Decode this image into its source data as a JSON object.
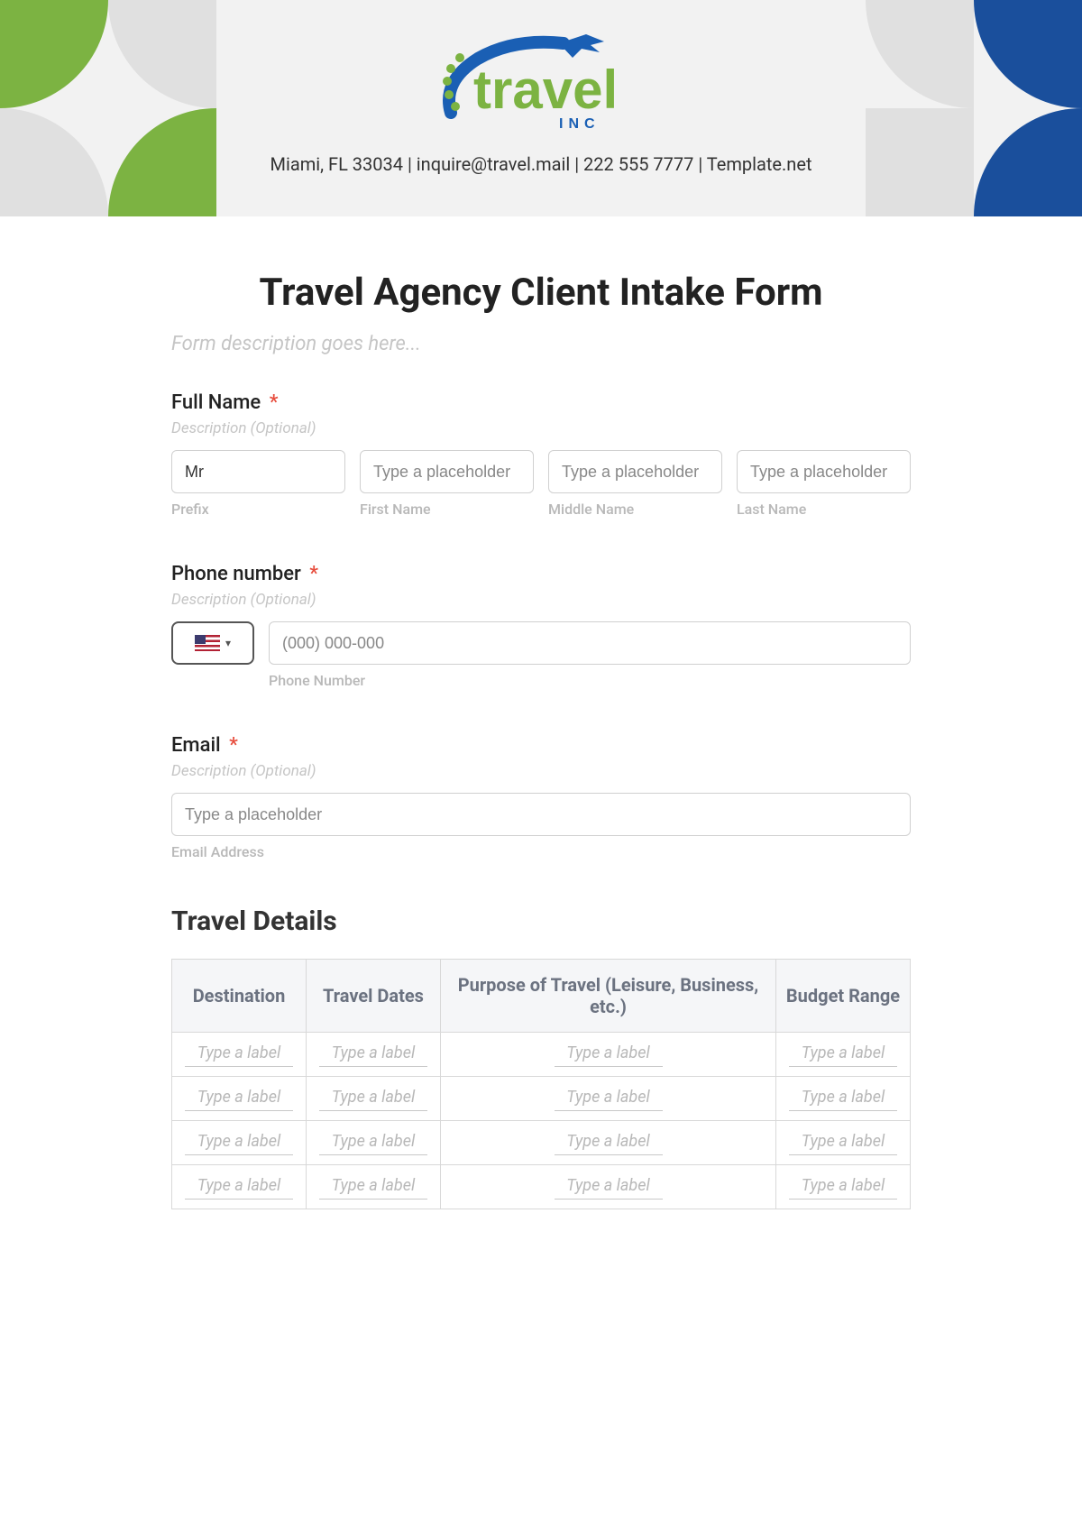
{
  "header": {
    "brand_main": "travel",
    "brand_sub": "I N C",
    "contact_line": "Miami, FL 33034 | inquire@travel.mail | 222 555 7777 | Template.net"
  },
  "form": {
    "title": "Travel Agency Client Intake Form",
    "description_placeholder": "Form description goes here...",
    "required_mark": "*",
    "full_name": {
      "label": "Full Name",
      "desc": "Description (Optional)",
      "prefix_value": "Mr",
      "first_placeholder": "Type a placeholder",
      "middle_placeholder": "Type a placeholder",
      "last_placeholder": "Type a placeholder",
      "prefix_sub": "Prefix",
      "first_sub": "First Name",
      "middle_sub": "Middle Name",
      "last_sub": "Last Name"
    },
    "phone": {
      "label": "Phone number",
      "desc": "Description (Optional)",
      "placeholder": "(000) 000-000",
      "sub": "Phone Number"
    },
    "email": {
      "label": "Email",
      "desc": "Description (Optional)",
      "placeholder": "Type a placeholder",
      "sub": "Email Address"
    }
  },
  "travel_details": {
    "heading": "Travel Details",
    "columns": [
      "Destination",
      "Travel Dates",
      "Purpose of Travel (Leisure, Business, etc.)",
      "Budget Range"
    ],
    "cell_placeholder": "Type a label",
    "row_count": 4
  }
}
